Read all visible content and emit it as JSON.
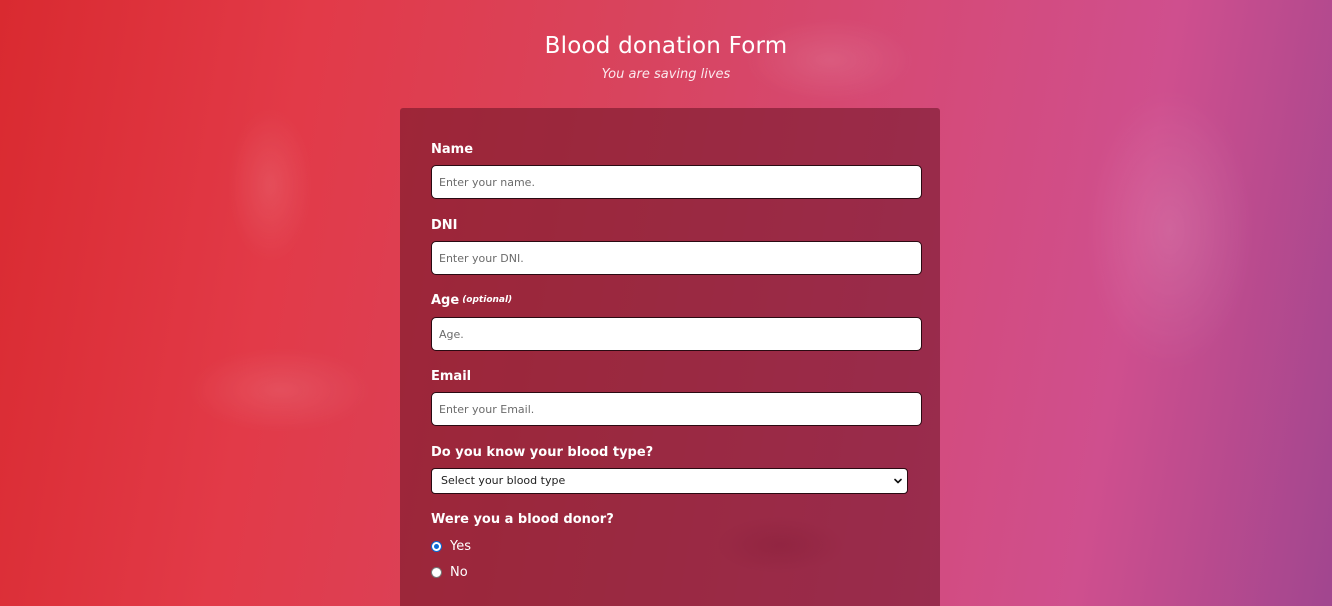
{
  "header": {
    "title": "Blood donation Form",
    "subtitle": "You are saving lives"
  },
  "form": {
    "name": {
      "label": "Name",
      "placeholder": "Enter your name.",
      "value": ""
    },
    "dni": {
      "label": "DNI",
      "placeholder": "Enter your DNI.",
      "value": ""
    },
    "age": {
      "label": "Age",
      "optional_tag": "(optional)",
      "placeholder": "Age.",
      "value": ""
    },
    "email": {
      "label": "Email",
      "placeholder": "Enter your Email.",
      "value": ""
    },
    "blood_type": {
      "label": "Do you know your blood type?",
      "selected": "Select your blood type"
    },
    "donor": {
      "label": "Were you a blood donor?",
      "options": [
        {
          "label": "Yes",
          "checked": true
        },
        {
          "label": "No",
          "checked": false
        }
      ]
    }
  },
  "colors": {
    "radio_accent": "#0b6bd6",
    "card_bg": "#6e1428",
    "background_left": "#d92a30",
    "background_right": "#a1468f"
  }
}
